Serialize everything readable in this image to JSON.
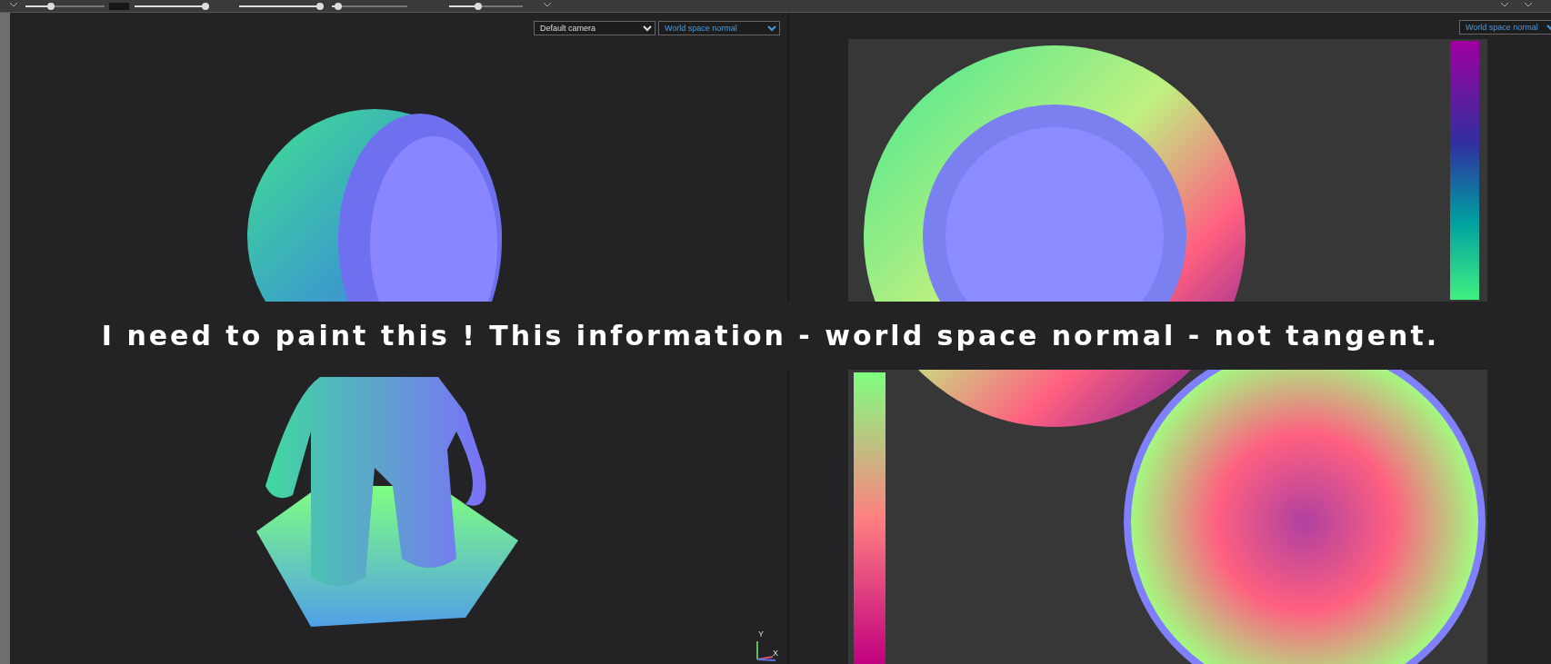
{
  "toolbar": {
    "sliders": [
      {
        "level": 0.32
      },
      {
        "level": 0.97
      },
      {
        "level": 0.97
      },
      {
        "level": 0.08
      },
      {
        "level": 0.4
      }
    ]
  },
  "viewport_3d": {
    "camera_dropdown": {
      "value": "Default camera"
    },
    "channel_dropdown": {
      "value": "World space normal"
    },
    "axis_gizmo": {
      "y_label": "Y",
      "x_label": "X"
    }
  },
  "viewport_2d": {
    "channel_dropdown": {
      "value": "World space normal"
    }
  },
  "caption": "I need to paint this ! This information - world space normal - not tangent."
}
